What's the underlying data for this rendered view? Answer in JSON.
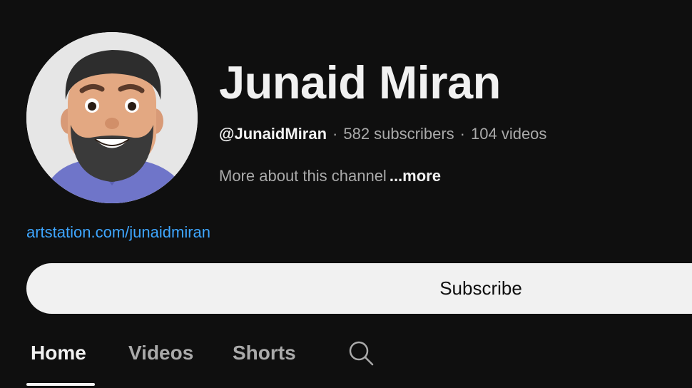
{
  "channel": {
    "name": "Junaid Miran",
    "handle": "@JunaidMiran",
    "subscribers": "582 subscribers",
    "videos": "104 videos",
    "separator": "·",
    "about": "More about this channel",
    "more": "...more",
    "link": "artstation.com/junaidmiran"
  },
  "subscribe": {
    "label": "Subscribe"
  },
  "tabs": [
    {
      "label": "Home",
      "active": true
    },
    {
      "label": "Videos",
      "active": false
    },
    {
      "label": "Shorts",
      "active": false
    }
  ],
  "icons": {
    "search": "search-icon"
  },
  "colors": {
    "background": "#0f0f0f",
    "link": "#3ea6ff",
    "button": "#f1f1f1",
    "muted": "#aaaaaa"
  }
}
